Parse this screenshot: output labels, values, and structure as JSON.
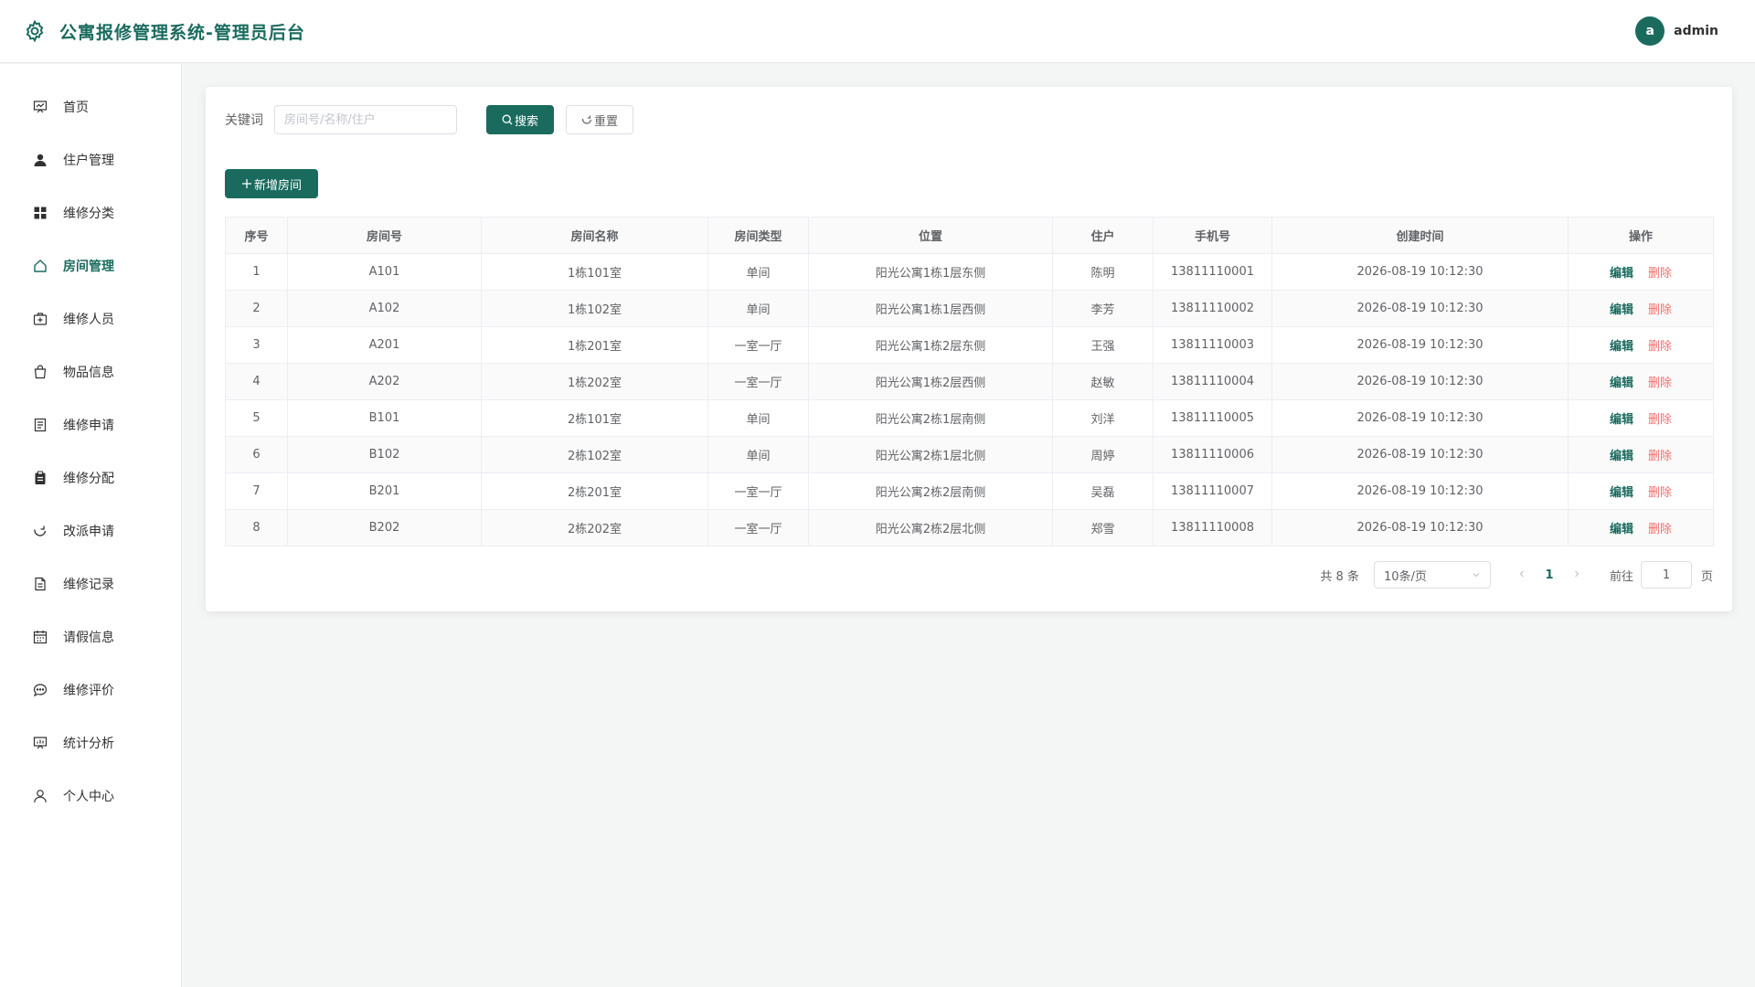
{
  "header": {
    "title": "公寓报修管理系统-管理员后台",
    "user_initial": "a",
    "username": "admin"
  },
  "sidebar": {
    "items": [
      {
        "label": "首页",
        "icon": "dashboard-icon"
      },
      {
        "label": "住户管理",
        "icon": "user-filled-icon"
      },
      {
        "label": "维修分类",
        "icon": "grid-icon"
      },
      {
        "label": "房间管理",
        "icon": "house-icon",
        "active": true
      },
      {
        "label": "维修人员",
        "icon": "first-aid-kit-icon"
      },
      {
        "label": "物品信息",
        "icon": "shopping-bag-icon"
      },
      {
        "label": "维修申请",
        "icon": "tickets-icon"
      },
      {
        "label": "维修分配",
        "icon": "clipboard-icon"
      },
      {
        "label": "改派申请",
        "icon": "refresh-icon"
      },
      {
        "label": "维修记录",
        "icon": "document-icon"
      },
      {
        "label": "请假信息",
        "icon": "calendar-icon"
      },
      {
        "label": "维修评价",
        "icon": "chat-icon"
      },
      {
        "label": "统计分析",
        "icon": "chart-board-icon"
      },
      {
        "label": "个人中心",
        "icon": "user-icon"
      }
    ]
  },
  "search": {
    "label": "关键词",
    "placeholder": "房间号/名称/住户",
    "value": "",
    "search_button": "搜索",
    "reset_button": "重置"
  },
  "add_button": "新增房间",
  "table": {
    "columns": [
      "序号",
      "房间号",
      "房间名称",
      "房间类型",
      "位置",
      "住户",
      "手机号",
      "创建时间",
      "操作"
    ],
    "edit_label": "编辑",
    "delete_label": "删除",
    "rows": [
      [
        "1",
        "A101",
        "1栋101室",
        "单间",
        "阳光公寓1栋1层东侧",
        "陈明",
        "13811110001",
        "2026-08-19 10:12:30"
      ],
      [
        "2",
        "A102",
        "1栋102室",
        "单间",
        "阳光公寓1栋1层西侧",
        "李芳",
        "13811110002",
        "2026-08-19 10:12:30"
      ],
      [
        "3",
        "A201",
        "1栋201室",
        "一室一厅",
        "阳光公寓1栋2层东侧",
        "王强",
        "13811110003",
        "2026-08-19 10:12:30"
      ],
      [
        "4",
        "A202",
        "1栋202室",
        "一室一厅",
        "阳光公寓1栋2层西侧",
        "赵敏",
        "13811110004",
        "2026-08-19 10:12:30"
      ],
      [
        "5",
        "B101",
        "2栋101室",
        "单间",
        "阳光公寓2栋1层南侧",
        "刘洋",
        "13811110005",
        "2026-08-19 10:12:30"
      ],
      [
        "6",
        "B102",
        "2栋102室",
        "单间",
        "阳光公寓2栋1层北侧",
        "周婷",
        "13811110006",
        "2026-08-19 10:12:30"
      ],
      [
        "7",
        "B201",
        "2栋201室",
        "一室一厅",
        "阳光公寓2栋2层南侧",
        "吴磊",
        "13811110007",
        "2026-08-19 10:12:30"
      ],
      [
        "8",
        "B202",
        "2栋202室",
        "一室一厅",
        "阳光公寓2栋2层北侧",
        "郑雪",
        "13811110008",
        "2026-08-19 10:12:30"
      ]
    ]
  },
  "pagination": {
    "total_text": "共 8 条",
    "page_size": "10条/页",
    "current_page": "1",
    "goto_label": "前往",
    "goto_value": "1",
    "page_unit": "页"
  },
  "colors": {
    "primary": "#1a6b5e",
    "danger": "#f56c6c",
    "background": "#f4f5f5"
  }
}
